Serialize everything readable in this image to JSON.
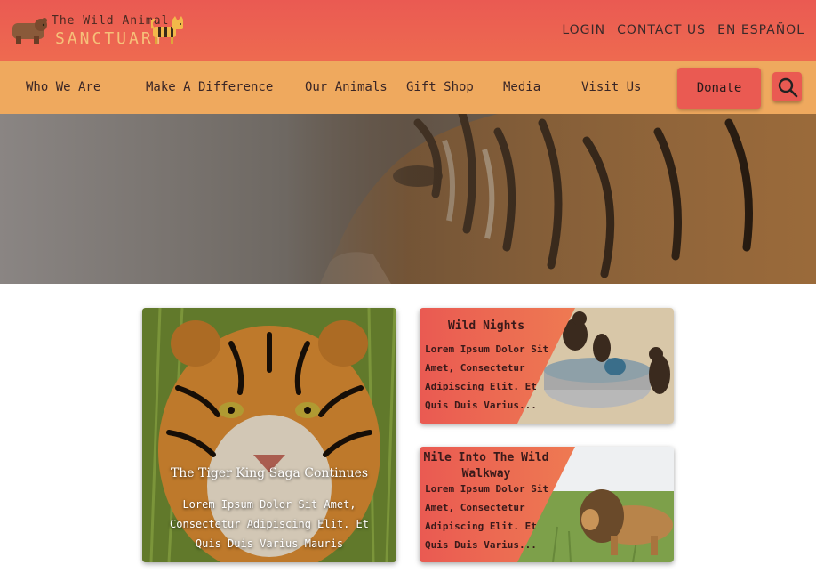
{
  "header": {
    "logo_line1": "The Wild Animal",
    "logo_line2": "SANCTUARY",
    "links": [
      "LOGIN",
      "CONTACT US",
      "EN ESPAÑOL"
    ]
  },
  "nav": {
    "items": [
      "Who We Are",
      "Make A Difference",
      "Our Animals",
      "Gift Shop",
      "Media",
      "Visit Us"
    ],
    "donate_label": "Donate",
    "search_icon": "search-icon"
  },
  "hero": {
    "image": "tiger-profile-photo"
  },
  "cards": {
    "featured": {
      "title": "The Tiger King Saga Continues",
      "description": "Lorem Ipsum Dolor Sit Amet, Consectetur Adipiscing Elit. Et Quis Duis Varius Mauris"
    },
    "wild_nights": {
      "title": "Wild Nights",
      "description": "Lorem Ipsum Dolor Sit Amet, Consectetur Adipiscing Elit. Et Quis Duis Varius..."
    },
    "walkway": {
      "title": "Mile Into The Wild Walkway",
      "description": "Lorem Ipsum Dolor Sit Amet, Consectetur Adipiscing Elit. Et Quis Duis Varius..."
    }
  },
  "colors": {
    "topbar": "#ea5a52",
    "navbar": "#efa95e",
    "donate": "#ea5a52",
    "logo_accent": "#f6c079"
  }
}
